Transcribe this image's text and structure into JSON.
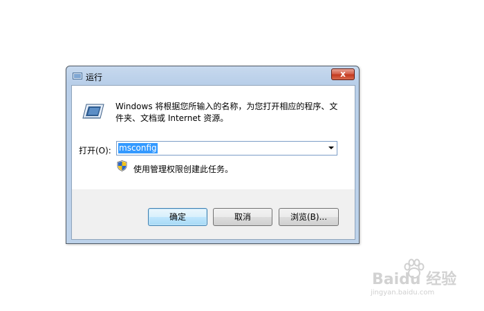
{
  "window": {
    "title": "运行",
    "close_label": "x"
  },
  "content": {
    "description": "Windows 将根据您所输入的名称，为您打开相应的程序、文件夹、文档或 Internet 资源。",
    "open_label": "打开(O):",
    "open_value": "msconfig",
    "admin_note": "使用管理权限创建此任务。"
  },
  "buttons": {
    "ok": "确定",
    "cancel": "取消",
    "browse": "浏览(B)..."
  },
  "watermark": {
    "brand": "Baidu 经验",
    "url": "jingyan.baidu.com"
  },
  "colors": {
    "selection": "#3399ff",
    "close_button": "#c33a1f",
    "titlebar": "#c7d9ee"
  }
}
